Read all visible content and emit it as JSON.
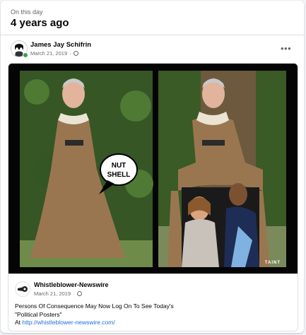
{
  "memory": {
    "label": "On this day",
    "title": "4 years ago"
  },
  "post": {
    "author": "James Jay Schifrin",
    "date": "March 21, 2019",
    "separator": "·",
    "more_label": "•••"
  },
  "shared": {
    "image": {
      "speech_bubble_line1": "NUT",
      "speech_bubble_line2": "SHELL",
      "watermark": "TAINT"
    },
    "page_name": "Whistleblower-Newswire",
    "date": "March 21, 2019",
    "separator": "·",
    "text_line1": "Persons Of Consequence May Now Log On To See Today's",
    "text_line2": "\"Political Posters\"",
    "text_line3_prefix": "At ",
    "link": "http://whistleblower-newswire.com/"
  },
  "colors": {
    "link": "#216fdb",
    "online": "#31a24c",
    "meta": "#65676b"
  }
}
